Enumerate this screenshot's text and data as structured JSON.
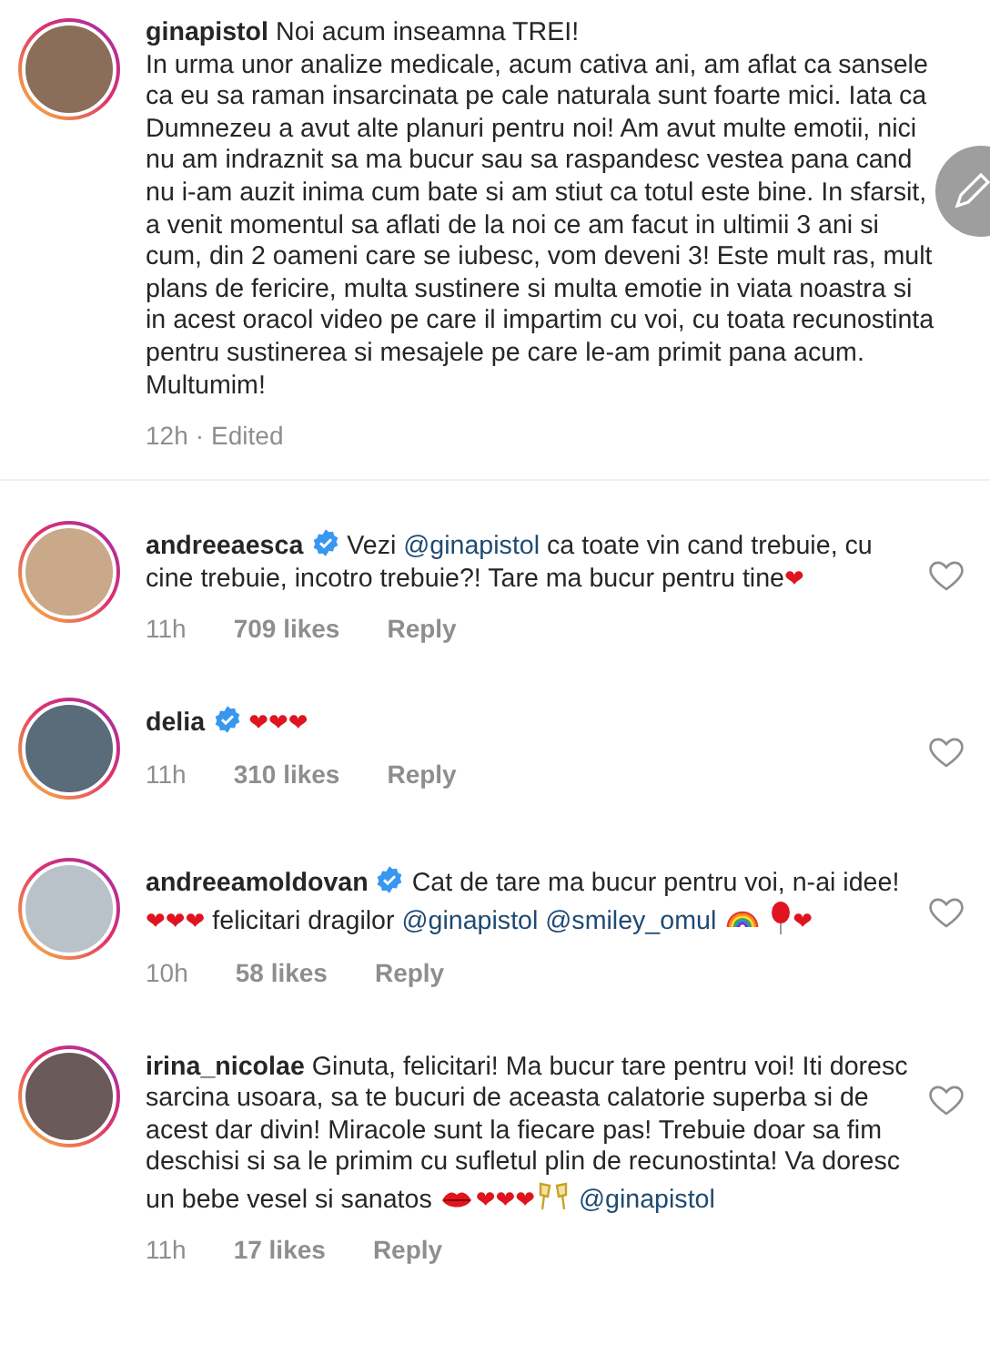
{
  "caption": {
    "username": "ginapistol",
    "verified": false,
    "segments": [
      {
        "kind": "text",
        "text": "Noi acum inseamna TREI!\nIn urma unor analize medicale, acum cativa ani, am aflat ca sansele ca eu sa raman insarcinata pe cale naturala sunt foarte mici. Iata ca Dumnezeu a avut alte planuri pentru noi! Am avut multe emotii, nici nu am indraznit sa ma bucur sau sa raspandesc vestea pana cand nu i-am auzit inima cum bate si am stiut ca totul este bine. In sfarsit, a venit momentul sa aflati de la noi ce am facut in ultimii 3 ani si cum, din 2 oameni care se iubesc, vom deveni 3! Este mult ras, mult plans de fericire, multa sustinere si multa emotie in viata noastra si in acest oracol video pe care il impartim cu voi, cu toata recunostinta pentru sustinerea si mesajele pe care le-am primit pana acum. Multumim!"
      }
    ],
    "time": "12h",
    "separator": "·",
    "edited": "Edited"
  },
  "comments": [
    {
      "username": "andreeaesca",
      "verified": true,
      "liked": false,
      "time": "11h",
      "likes": "709 likes",
      "reply": "Reply",
      "segments": [
        {
          "kind": "text",
          "text": "Vezi "
        },
        {
          "kind": "mention",
          "text": "@ginapistol"
        },
        {
          "kind": "text",
          "text": " ca toate vin cand trebuie, cu cine trebuie, incotro trebuie?! Tare ma bucur pentru tine"
        },
        {
          "kind": "heart",
          "text": "❤"
        }
      ]
    },
    {
      "username": "delia",
      "verified": true,
      "liked": false,
      "time": "11h",
      "likes": "310 likes",
      "reply": "Reply",
      "segments": [
        {
          "kind": "heart",
          "text": "❤❤❤"
        }
      ]
    },
    {
      "username": "andreeamoldovan",
      "verified": true,
      "liked": false,
      "time": "10h",
      "likes": "58 likes",
      "reply": "Reply",
      "segments": [
        {
          "kind": "text",
          "text": "Cat de tare ma bucur pentru voi, n-ai idee! "
        },
        {
          "kind": "heart",
          "text": "❤❤❤"
        },
        {
          "kind": "text",
          "text": " felicitari dragilor "
        },
        {
          "kind": "mention",
          "text": "@ginapistol"
        },
        {
          "kind": "gap"
        },
        {
          "kind": "mention",
          "text": "@smiley_omul"
        },
        {
          "kind": "gap"
        },
        {
          "kind": "rainbow"
        },
        {
          "kind": "gap"
        },
        {
          "kind": "balloon"
        },
        {
          "kind": "heart",
          "text": "❤"
        }
      ]
    },
    {
      "username": "irina_nicolae",
      "verified": false,
      "liked": false,
      "time": "11h",
      "likes": "17 likes",
      "reply": "Reply",
      "segments": [
        {
          "kind": "text",
          "text": "Ginuta, felicitari! Ma bucur tare pentru voi! Iti doresc sarcina usoara, sa te bucuri de aceasta calatorie superba si de acest dar divin! Miracole sunt la fiecare pas! Trebuie doar sa fim deschisi si sa le primim cu sufletul plin de recunostinta! Va doresc un bebe vesel si sanatos "
        },
        {
          "kind": "kiss"
        },
        {
          "kind": "heart",
          "text": "❤❤❤"
        },
        {
          "kind": "cheers"
        },
        {
          "kind": "gap"
        },
        {
          "kind": "mention",
          "text": "@ginapistol"
        }
      ]
    }
  ]
}
